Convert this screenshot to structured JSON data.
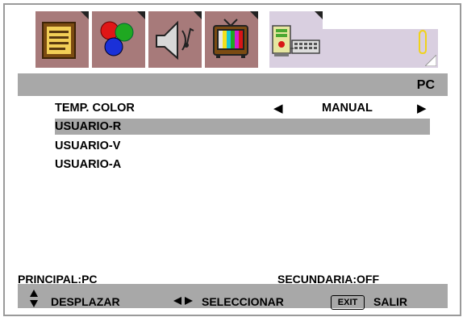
{
  "tabs": [
    {
      "name": "image-menu",
      "icon": "document-picture-icon",
      "active": false
    },
    {
      "name": "color-menu",
      "icon": "rgb-circles-icon",
      "active": false
    },
    {
      "name": "audio-menu",
      "icon": "speaker-icon",
      "active": false
    },
    {
      "name": "tv-menu",
      "icon": "tv-icon",
      "active": false
    },
    {
      "name": "pc-menu",
      "icon": "pc-computer-icon",
      "active": true
    }
  ],
  "header": {
    "title": "PC"
  },
  "menu": {
    "items": [
      {
        "label": "TEMP. COLOR",
        "value": "MANUAL"
      },
      {
        "label": "USUARIO-R"
      },
      {
        "label": "USUARIO-V"
      },
      {
        "label": "USUARIO-A"
      }
    ],
    "left_arrow": "◀",
    "right_arrow": "▶"
  },
  "status": {
    "left": "PRINCIPAL:PC",
    "right": "SECUNDARIA:OFF"
  },
  "footer": {
    "scroll_label": "DESPLAZAR",
    "select_label": "SELECCIONAR",
    "exit_key": "EXIT",
    "exit_label": "SALIR"
  },
  "colors": {
    "bar": "#a8a8a8",
    "tab": "#a77a7a",
    "active_tab": "#d9cfe0"
  }
}
